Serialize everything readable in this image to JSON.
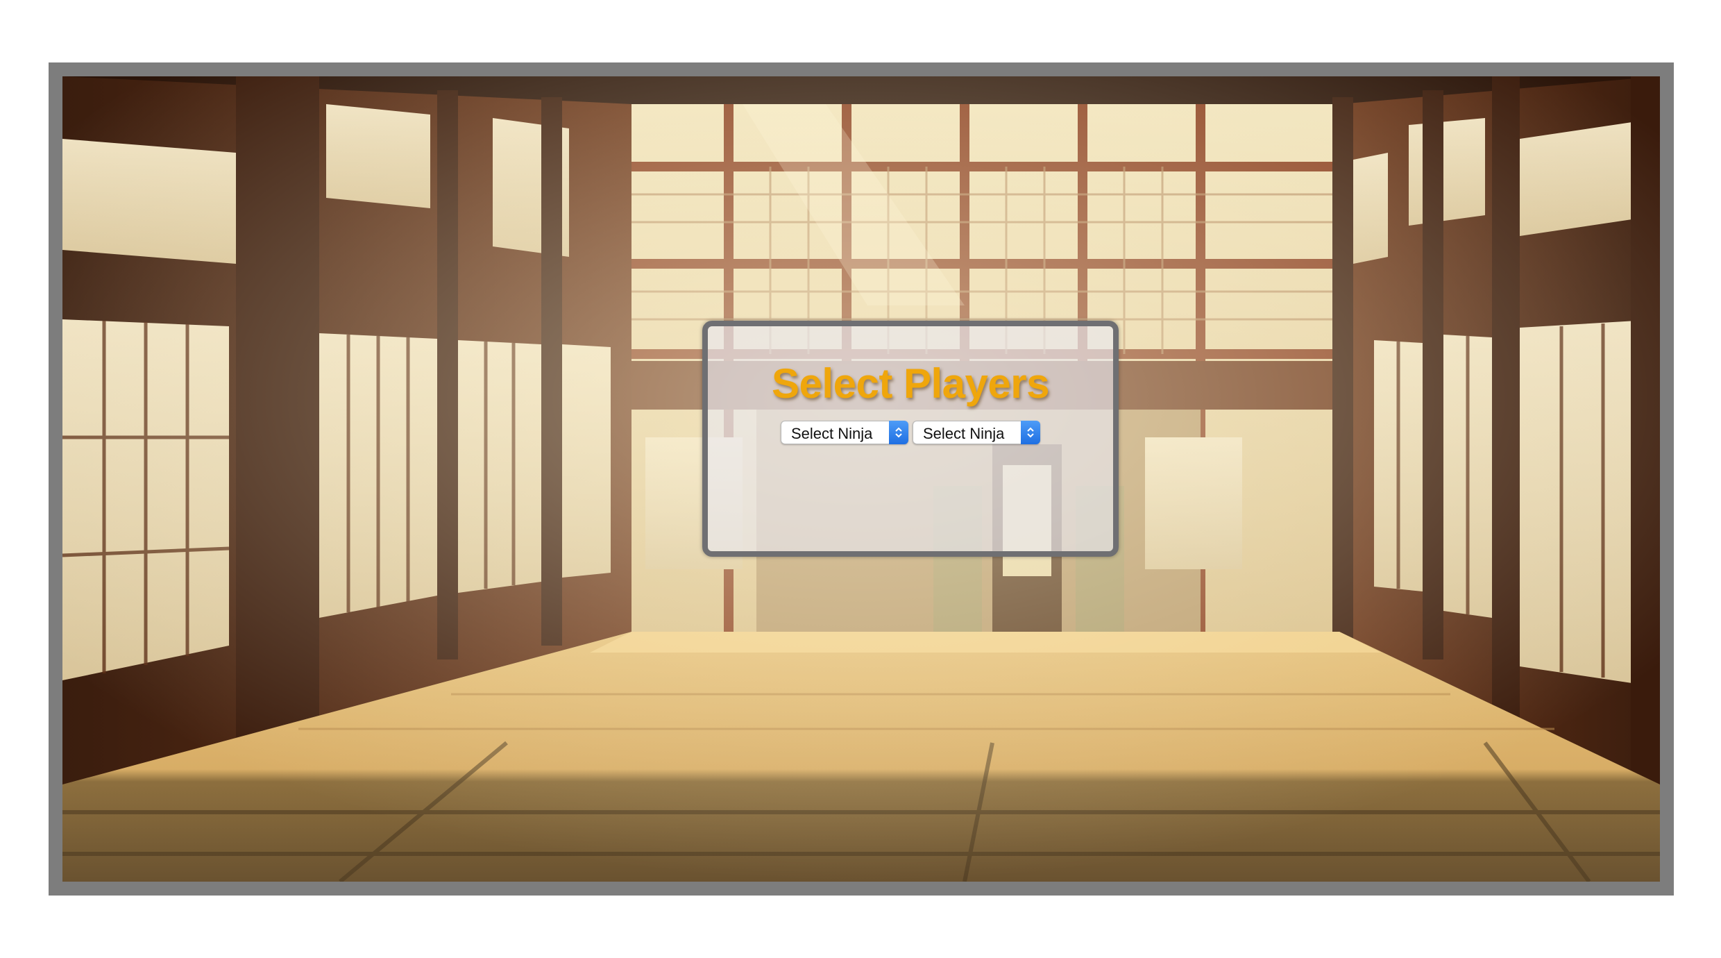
{
  "game": {
    "title": "Select Players",
    "player_selects": [
      {
        "value": "Select Ninja",
        "icon": "chevron-up-down-icon"
      },
      {
        "value": "Select Ninja",
        "icon": "chevron-up-down-icon"
      }
    ]
  },
  "colors": {
    "title": "#efa60c",
    "frame": "#7d7d7d",
    "panel_border": "#6f6f72",
    "select_accent": "#1f6fe2"
  }
}
